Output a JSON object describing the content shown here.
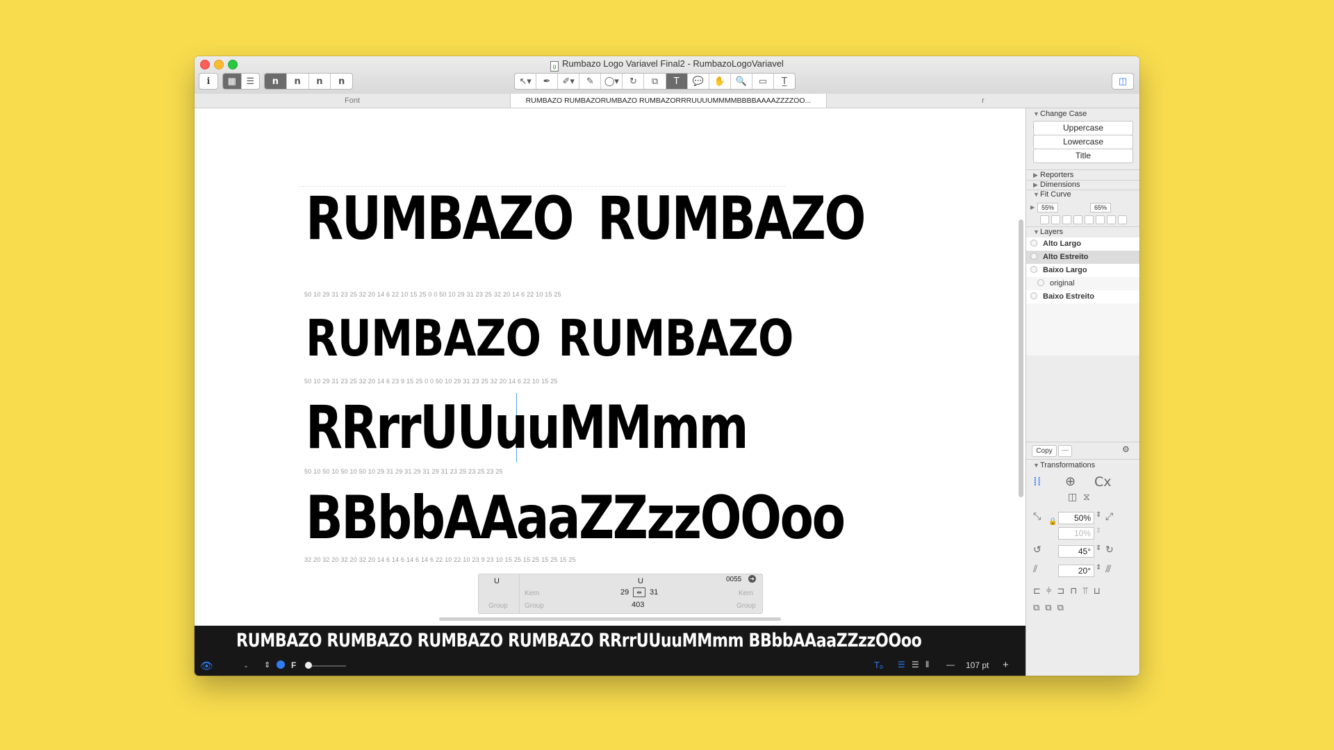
{
  "window": {
    "title": "Rumbazo Logo Variavel Final2 - RumbazoLogoVariavel",
    "doc_icon": "glyphs-doc-icon"
  },
  "toolbar": {
    "info_label": "i",
    "n_buttons": [
      "n",
      "n",
      "n",
      "n"
    ],
    "tools": [
      "↖▾",
      "✒",
      "✐▾",
      "✎",
      "◯▾",
      "↻",
      "⧉",
      "T",
      "💬",
      "✋",
      "🔍",
      "▭",
      "T̲"
    ]
  },
  "tabs": {
    "left": "Font",
    "center": "RUMBAZO RUMBAZORUMBAZO RUMBAZORRRUUUUMMMMBBBBAAAAZZZZOO...",
    "right": "r"
  },
  "glyph_lines": [
    {
      "parts": [
        "RUMBAZO",
        "RUMBAZO"
      ],
      "metrics": "50      10  29      31  23      25  32      20  14      6  22    10  15      25  0      0  50      10  29      31  23      25  32      20  14      6  22 10  15      25"
    },
    {
      "parts": [
        "RUMBAZO",
        "RUMBAZO"
      ],
      "metrics": "50      10  29      31  23      25  32      20  14      6  23      9  15      25  0      0  50      10  29      31  23      25  32      20  14      6  22    10  15      25"
    },
    {
      "parts": [
        "RRrrUUuuMMmm"
      ],
      "metrics": "50    10  50    10  50    10  50    10  29    31  29    31  29    31  29    31  23    25  23    25  23    25"
    },
    {
      "parts": [
        "BBbbAAaaZZzzOOoo"
      ],
      "metrics": "32      20  32    20  32      20  32    20  14    6  14    6  14    6  14    6  22    10  22  10  23    9  23  10  15    25  15    25  15    25  15    25"
    }
  ],
  "info_box": {
    "left_glyph": "U",
    "center_glyph": "U",
    "unicode": "0055",
    "kern_left_label": "Kern",
    "kern_right_label": "Kern",
    "lsb": "29",
    "rsb": "31",
    "width": "403",
    "group_left": "Group",
    "group_center": "Group",
    "group_right": "Group"
  },
  "preview": {
    "text": "RUMBAZO  RUMBAZO RUMBAZO  RUMBAZO RRrrUUuuMMmm BBbbAAaaZZzzOOoo",
    "bottom_dash": "-",
    "bottom_f": "F",
    "size": "107 pt",
    "minus": "—",
    "plus": "+"
  },
  "panel": {
    "change_case": "Change Case",
    "uppercase": "Uppercase",
    "lowercase": "Lowercase",
    "title": "Title",
    "reporters": "Reporters",
    "dimensions": "Dimensions",
    "fit_curve": "Fit Curve",
    "fit_min": "55%",
    "fit_max": "65%",
    "layers_header": "Layers",
    "layers": [
      "Alto Largo",
      "Alto Estreito",
      "Baixo Largo",
      "original",
      "Baixo Estreito"
    ],
    "copy": "Copy",
    "transformations": "Transformations",
    "scale": "50%",
    "scale2": "10%",
    "rotate": "45°",
    "slant": "20°"
  }
}
